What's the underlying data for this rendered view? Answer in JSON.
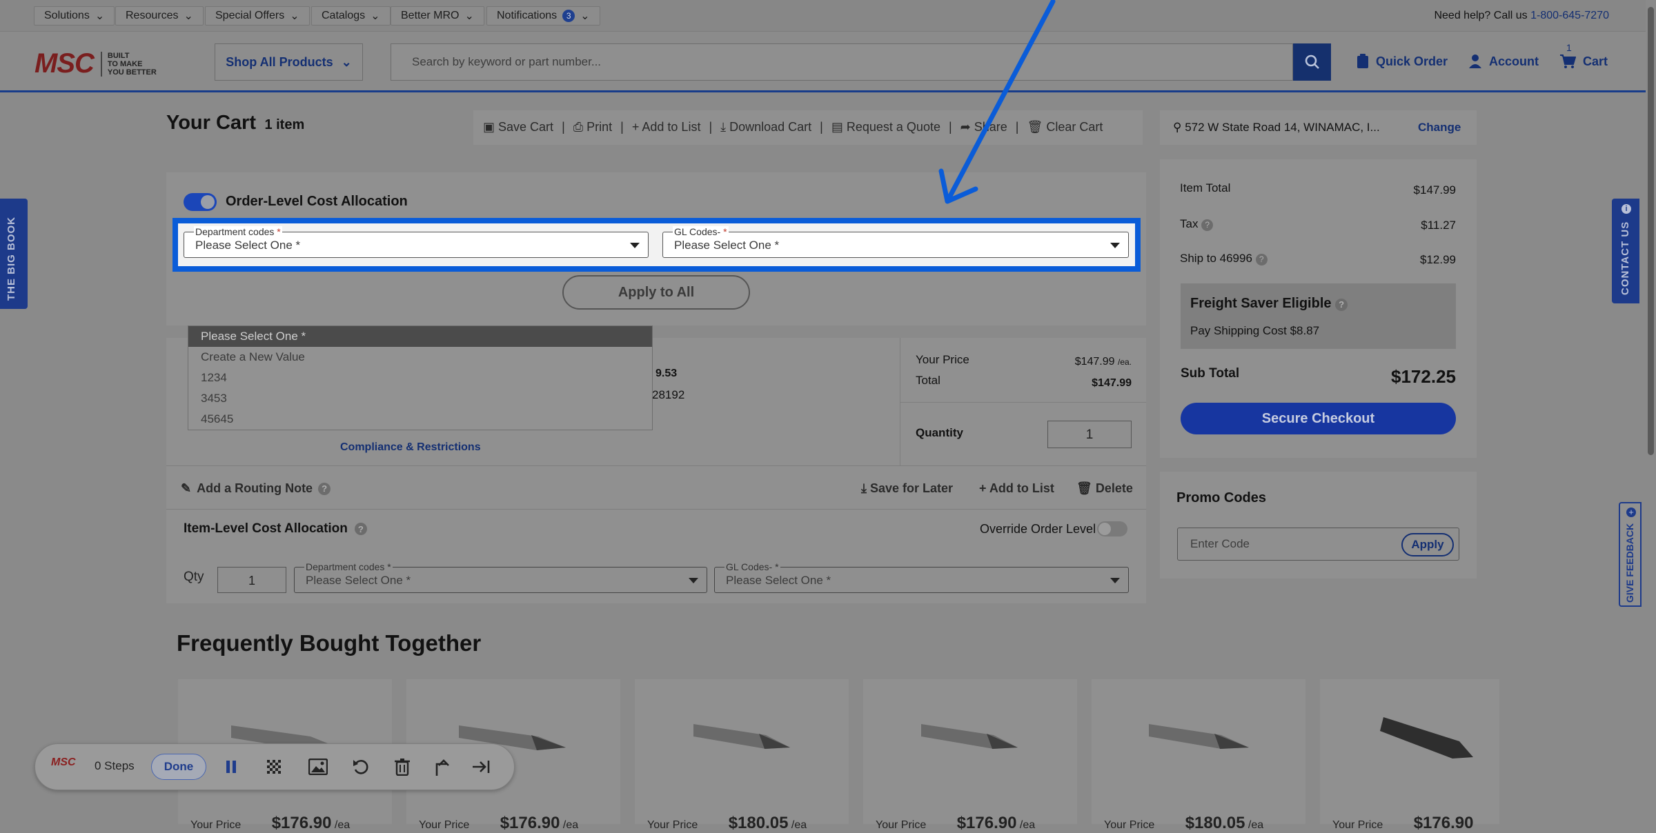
{
  "utility_bar": {
    "menus": [
      "Solutions",
      "Resources",
      "Special Offers",
      "Catalogs",
      "Better MRO",
      "Notifications"
    ],
    "notifications_count": "3",
    "help_text": "Need help? Call us",
    "phone": "1-800-645-7270"
  },
  "header": {
    "logo_text": "MSC",
    "tagline": [
      "BUILT",
      "TO MAKE",
      "YOU BETTER"
    ],
    "shop_all": "Shop All Products",
    "search_placeholder": "Search by keyword or part number...",
    "quick_order": "Quick Order",
    "account": "Account",
    "cart": "Cart",
    "cart_count": "1"
  },
  "cart": {
    "title": "Your Cart",
    "item_count": "1 item",
    "actions": [
      "Save Cart",
      "Print",
      "Add to List",
      "Download Cart",
      "Request a Quote",
      "Share",
      "Clear Cart"
    ]
  },
  "order_allocation": {
    "title": "Order-Level Cost Allocation",
    "toggle_on": true,
    "department_label": "Department codes",
    "gl_label": "GL Codes-",
    "required_mark": "*",
    "select_value": "Please Select One *",
    "apply_label": "Apply to All"
  },
  "dropdown_options": [
    "Please Select One *",
    "Create a New Value",
    "1234",
    "3453",
    "45645"
  ],
  "line_item": {
    "partial_price": "9.53",
    "partial_number": "28192",
    "compliance": "Compliance & Restrictions",
    "your_price_label": "Your Price",
    "your_price": "$147.99",
    "per_unit": "/ea.",
    "total_label": "Total",
    "total": "$147.99",
    "quantity_label": "Quantity",
    "quantity": "1",
    "routing_note": "Add a Routing Note",
    "save_later": "Save for Later",
    "add_to_list": "Add to List",
    "delete": "Delete"
  },
  "item_allocation": {
    "title": "Item-Level Cost Allocation",
    "override_label": "Override Order Level",
    "qty_label": "Qty",
    "qty_value": "1",
    "department_label": "Department codes",
    "gl_label": "GL Codes-",
    "select_value": "Please Select One *"
  },
  "summary": {
    "address": "572 W State Road 14, WINAMAC, I...",
    "change": "Change",
    "item_total_label": "Item Total",
    "item_total": "$147.99",
    "tax_label": "Tax",
    "tax": "$11.27",
    "ship_label": "Ship to 46996",
    "ship": "$12.99",
    "freight_title": "Freight Saver Eligible",
    "freight_text": "Pay Shipping Cost $8.87",
    "subtotal_label": "Sub Total",
    "subtotal": "$172.25",
    "checkout": "Secure Checkout"
  },
  "promo": {
    "title": "Promo Codes",
    "placeholder": "Enter Code",
    "apply": "Apply"
  },
  "side_tabs": {
    "big_book": "THE BIG BOOK",
    "contact": "CONTACT US",
    "feedback": "GIVE FEEDBACK"
  },
  "fbt": {
    "title": "Frequently Bought Together",
    "price_label": "Your Price",
    "prices": [
      "$176.90",
      "$176.90",
      "$180.05",
      "$176.90",
      "$180.05",
      "$176.90"
    ],
    "unit": "/ea"
  },
  "recorder": {
    "logo": "MSC",
    "steps": "0 Steps",
    "done": "Done"
  },
  "colors": {
    "highlight": "#0a5cd8",
    "navy": "#142f72",
    "checkout": "#1736a0"
  }
}
